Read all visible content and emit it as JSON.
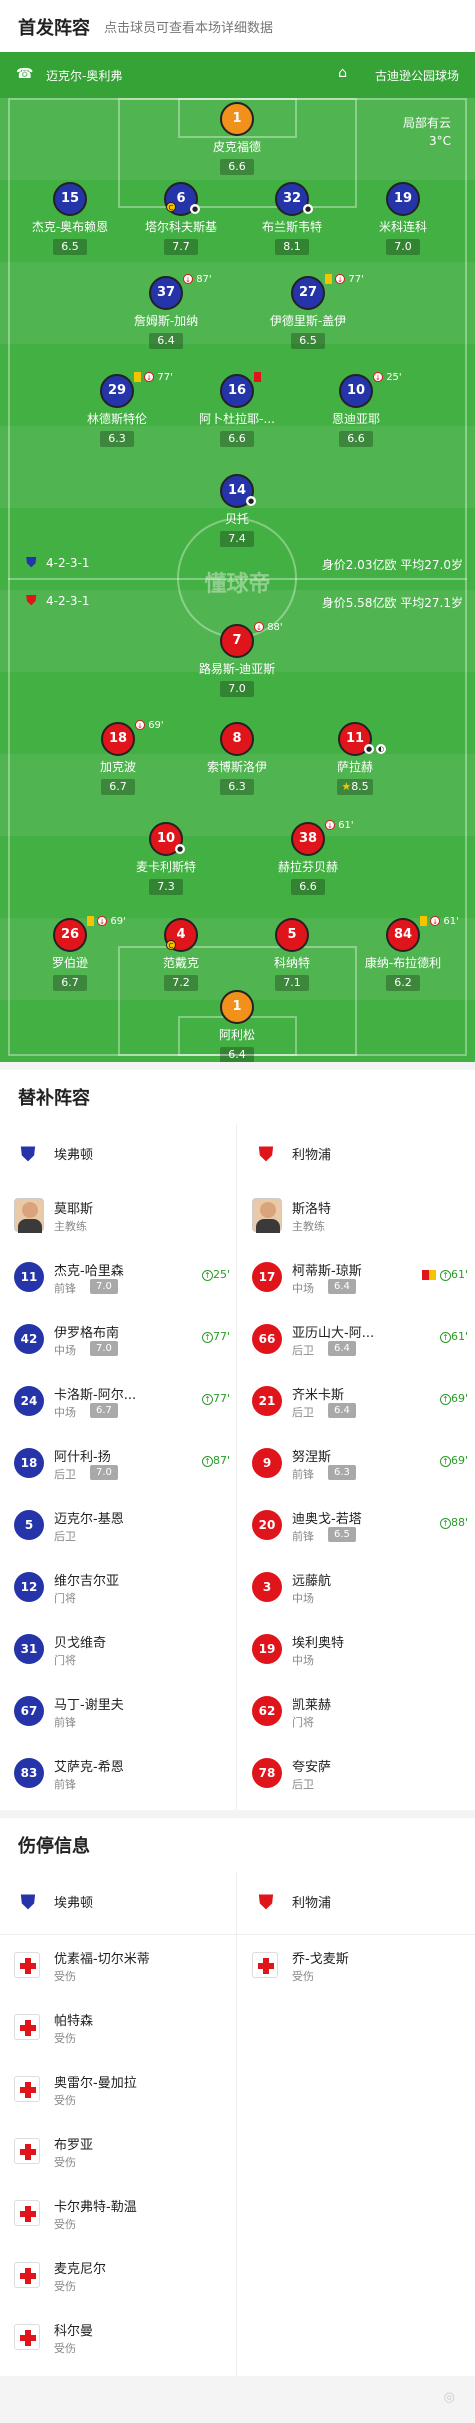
{
  "header": {
    "title": "首发阵容",
    "subtitle": "点击球员可查看本场详细数据"
  },
  "pitch": {
    "home_team": "迈克尔-奥利弗",
    "venue": "古迪逊公园球场",
    "weather_line1": "局部有云",
    "weather_line2": "3°C",
    "watermark": "懂球帝",
    "home_formation": "4-2-3-1",
    "home_value": "身价2.03亿欧 平均27.0岁",
    "away_formation": "4-2-3-1",
    "away_value": "身价5.58亿欧 平均27.1岁",
    "players": [
      {
        "num": "1",
        "name": "皮克福德",
        "rating": "6.6",
        "team": "orange",
        "events": ""
      },
      {
        "num": "15",
        "name": "杰克-奥布赖恩",
        "rating": "6.5",
        "team": "blue",
        "events": ""
      },
      {
        "num": "6",
        "name": "塔尔科夫斯基",
        "rating": "7.7",
        "team": "blue",
        "events": ""
      },
      {
        "num": "32",
        "name": "布兰斯韦特",
        "rating": "8.1",
        "team": "blue",
        "events": ""
      },
      {
        "num": "19",
        "name": "米科连科",
        "rating": "7.0",
        "team": "blue",
        "events": ""
      },
      {
        "num": "37",
        "name": "詹姆斯-加纳",
        "rating": "6.4",
        "team": "blue",
        "events": "87'"
      },
      {
        "num": "27",
        "name": "伊德里斯-盖伊",
        "rating": "6.5",
        "team": "blue",
        "events": "77'"
      },
      {
        "num": "29",
        "name": "林德斯特伦",
        "rating": "6.3",
        "team": "blue",
        "events": "77'"
      },
      {
        "num": "16",
        "name": "阿卜杜拉耶-...",
        "rating": "6.6",
        "team": "blue",
        "events": ""
      },
      {
        "num": "10",
        "name": "恩迪亚耶",
        "rating": "6.6",
        "team": "blue",
        "events": "25'"
      },
      {
        "num": "14",
        "name": "贝托",
        "rating": "7.4",
        "team": "blue",
        "events": ""
      },
      {
        "num": "7",
        "name": "路易斯-迪亚斯",
        "rating": "7.0",
        "team": "red",
        "events": "88'"
      },
      {
        "num": "18",
        "name": "加克波",
        "rating": "6.7",
        "team": "red",
        "events": "69'"
      },
      {
        "num": "8",
        "name": "索博斯洛伊",
        "rating": "6.3",
        "team": "red",
        "events": ""
      },
      {
        "num": "11",
        "name": "萨拉赫",
        "rating": "8.5",
        "team": "red",
        "events": ""
      },
      {
        "num": "10",
        "name": "麦卡利斯特",
        "rating": "7.3",
        "team": "red",
        "events": ""
      },
      {
        "num": "38",
        "name": "赫拉芬贝赫",
        "rating": "6.6",
        "team": "red",
        "events": "61'"
      },
      {
        "num": "26",
        "name": "罗伯逊",
        "rating": "6.7",
        "team": "red",
        "events": "69'"
      },
      {
        "num": "4",
        "name": "范戴克",
        "rating": "7.2",
        "team": "red",
        "events": ""
      },
      {
        "num": "5",
        "name": "科纳特",
        "rating": "7.1",
        "team": "red",
        "events": ""
      },
      {
        "num": "84",
        "name": "康纳-布拉德利",
        "rating": "6.2",
        "team": "red",
        "events": "61'"
      },
      {
        "num": "1",
        "name": "阿利松",
        "rating": "6.4",
        "team": "orange",
        "events": ""
      }
    ]
  },
  "subs": {
    "title": "替补阵容",
    "home_team": "埃弗顿",
    "away_team": "利物浦",
    "home_coach": {
      "name": "莫耶斯",
      "role": "主教练"
    },
    "away_coach": {
      "name": "斯洛特",
      "role": "主教练"
    },
    "home": [
      {
        "num": "11",
        "name": "杰克-哈里森",
        "pos": "前锋",
        "rating": "7.0",
        "sub": "25'"
      },
      {
        "num": "42",
        "name": "伊罗格布南",
        "pos": "中场",
        "rating": "7.0",
        "sub": "77'"
      },
      {
        "num": "24",
        "name": "卡洛斯-阿尔...",
        "pos": "中场",
        "rating": "6.7",
        "sub": "77'"
      },
      {
        "num": "18",
        "name": "阿什利-扬",
        "pos": "后卫",
        "rating": "7.0",
        "sub": "87'"
      },
      {
        "num": "5",
        "name": "迈克尔-基恩",
        "pos": "后卫",
        "rating": "",
        "sub": ""
      },
      {
        "num": "12",
        "name": "维尔吉尔亚",
        "pos": "门将",
        "rating": "",
        "sub": ""
      },
      {
        "num": "31",
        "name": "贝戈维奇",
        "pos": "门将",
        "rating": "",
        "sub": ""
      },
      {
        "num": "67",
        "name": "马丁-谢里夫",
        "pos": "前锋",
        "rating": "",
        "sub": ""
      },
      {
        "num": "83",
        "name": "艾萨克-希恩",
        "pos": "前锋",
        "rating": "",
        "sub": ""
      }
    ],
    "away": [
      {
        "num": "17",
        "name": "柯蒂斯-琼斯",
        "pos": "中场",
        "rating": "6.4",
        "sub": "61'"
      },
      {
        "num": "66",
        "name": "亚历山大-阿...",
        "pos": "后卫",
        "rating": "6.4",
        "sub": "61'"
      },
      {
        "num": "21",
        "name": "齐米卡斯",
        "pos": "后卫",
        "rating": "6.4",
        "sub": "69'"
      },
      {
        "num": "9",
        "name": "努涅斯",
        "pos": "前锋",
        "rating": "6.3",
        "sub": "69'"
      },
      {
        "num": "20",
        "name": "迪奥戈-若塔",
        "pos": "前锋",
        "rating": "6.5",
        "sub": "88'"
      },
      {
        "num": "3",
        "name": "远藤航",
        "pos": "中场",
        "rating": "",
        "sub": ""
      },
      {
        "num": "19",
        "name": "埃利奥特",
        "pos": "中场",
        "rating": "",
        "sub": ""
      },
      {
        "num": "62",
        "name": "凯莱赫",
        "pos": "门将",
        "rating": "",
        "sub": ""
      },
      {
        "num": "78",
        "name": "夸安萨",
        "pos": "后卫",
        "rating": "",
        "sub": ""
      }
    ]
  },
  "injuries": {
    "title": "伤停信息",
    "home_team": "埃弗顿",
    "away_team": "利物浦",
    "home": [
      {
        "name": "优素福-切尔米蒂",
        "status": "受伤"
      },
      {
        "name": "帕特森",
        "status": "受伤"
      },
      {
        "name": "奥雷尔-曼加拉",
        "status": "受伤"
      },
      {
        "name": "布罗亚",
        "status": "受伤"
      },
      {
        "name": "卡尔弗特-勒温",
        "status": "受伤"
      },
      {
        "name": "麦克尼尔",
        "status": "受伤"
      },
      {
        "name": "科尔曼",
        "status": "受伤"
      }
    ],
    "away": [
      {
        "name": "乔-戈麦斯",
        "status": "受伤"
      }
    ]
  },
  "colors": {
    "pitch": "#43b043",
    "home": "#2534a8",
    "away": "#e0151c",
    "keeper": "#f2901c"
  }
}
